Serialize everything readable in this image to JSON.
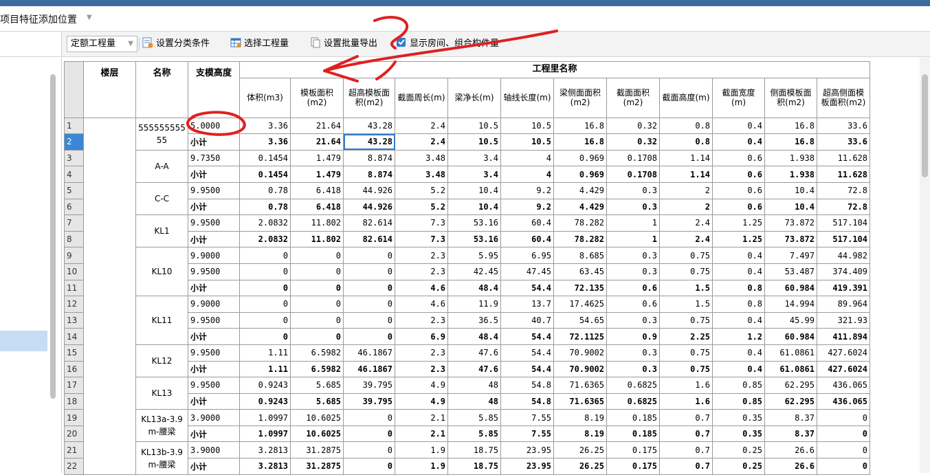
{
  "title_bar": {
    "title": "项目特征添加位置"
  },
  "toolbar": {
    "combo_value": "定额工程量",
    "buttons": [
      "设置分类条件",
      "选择工程量",
      "设置批量导出",
      "显示房间、组合构件量"
    ]
  },
  "colors": {
    "accent": "#3b86d6",
    "annotation": "#e02020",
    "header_bg": "#e6e6e6"
  },
  "table": {
    "group_header": "工程里名称",
    "fixed_headers": [
      "楼层",
      "名称",
      "支模高度"
    ],
    "columns": [
      "体积(m3)",
      "模板面积(m2)",
      "超高模板面积(m2)",
      "截面周长(m)",
      "梁净长(m)",
      "轴线长度(m)",
      "梁侧面面积(m2)",
      "截面面积(m2)",
      "截面高度(m)",
      "截面宽度(m)",
      "侧面模板面积(m2)",
      "超高侧面模板面积(m2)"
    ],
    "groups": [
      {
        "name": "55555555555",
        "rows": [
          {
            "n": "1",
            "h": "5.0000",
            "v": [
              "3.36",
              "21.64",
              "43.28",
              "2.4",
              "10.5",
              "10.5",
              "16.8",
              "0.32",
              "0.8",
              "0.4",
              "16.8",
              "33.6"
            ]
          },
          {
            "n": "2",
            "h": "小计",
            "v": [
              "3.36",
              "21.64",
              "43.28",
              "2.4",
              "10.5",
              "10.5",
              "16.8",
              "0.32",
              "0.8",
              "0.4",
              "16.8",
              "33.6"
            ]
          }
        ]
      },
      {
        "name": "A-A",
        "rows": [
          {
            "n": "3",
            "h": "9.7350",
            "v": [
              "0.1454",
              "1.479",
              "8.874",
              "3.48",
              "3.4",
              "4",
              "0.969",
              "0.1708",
              "1.14",
              "0.6",
              "1.938",
              "11.628"
            ]
          },
          {
            "n": "4",
            "h": "小计",
            "v": [
              "0.1454",
              "1.479",
              "8.874",
              "3.48",
              "3.4",
              "4",
              "0.969",
              "0.1708",
              "1.14",
              "0.6",
              "1.938",
              "11.628"
            ]
          }
        ]
      },
      {
        "name": "C-C",
        "rows": [
          {
            "n": "5",
            "h": "9.9500",
            "v": [
              "0.78",
              "6.418",
              "44.926",
              "5.2",
              "10.4",
              "9.2",
              "4.429",
              "0.3",
              "2",
              "0.6",
              "10.4",
              "72.8"
            ]
          },
          {
            "n": "6",
            "h": "小计",
            "v": [
              "0.78",
              "6.418",
              "44.926",
              "5.2",
              "10.4",
              "9.2",
              "4.429",
              "0.3",
              "2",
              "0.6",
              "10.4",
              "72.8"
            ]
          }
        ]
      },
      {
        "name": "KL1",
        "rows": [
          {
            "n": "7",
            "h": "9.9500",
            "v": [
              "2.0832",
              "11.802",
              "82.614",
              "7.3",
              "53.16",
              "60.4",
              "78.282",
              "1",
              "2.4",
              "1.25",
              "73.872",
              "517.104"
            ]
          },
          {
            "n": "8",
            "h": "小计",
            "v": [
              "2.0832",
              "11.802",
              "82.614",
              "7.3",
              "53.16",
              "60.4",
              "78.282",
              "1",
              "2.4",
              "1.25",
              "73.872",
              "517.104"
            ]
          }
        ]
      },
      {
        "name": "KL10",
        "rows": [
          {
            "n": "9",
            "h": "9.9000",
            "v": [
              "0",
              "0",
              "0",
              "2.3",
              "5.95",
              "6.95",
              "8.685",
              "0.3",
              "0.75",
              "0.4",
              "7.497",
              "44.982"
            ]
          },
          {
            "n": "10",
            "h": "9.9500",
            "v": [
              "0",
              "0",
              "0",
              "2.3",
              "42.45",
              "47.45",
              "63.45",
              "0.3",
              "0.75",
              "0.4",
              "53.487",
              "374.409"
            ]
          },
          {
            "n": "11",
            "h": "小计",
            "v": [
              "0",
              "0",
              "0",
              "4.6",
              "48.4",
              "54.4",
              "72.135",
              "0.6",
              "1.5",
              "0.8",
              "60.984",
              "419.391"
            ]
          }
        ]
      },
      {
        "name": "KL11",
        "rows": [
          {
            "n": "12",
            "h": "9.9000",
            "v": [
              "0",
              "0",
              "0",
              "4.6",
              "11.9",
              "13.7",
              "17.4625",
              "0.6",
              "1.5",
              "0.8",
              "14.994",
              "89.964"
            ]
          },
          {
            "n": "13",
            "h": "9.9500",
            "v": [
              "0",
              "0",
              "0",
              "2.3",
              "36.5",
              "40.7",
              "54.65",
              "0.3",
              "0.75",
              "0.4",
              "45.99",
              "321.93"
            ]
          },
          {
            "n": "14",
            "h": "小计",
            "v": [
              "0",
              "0",
              "0",
              "6.9",
              "48.4",
              "54.4",
              "72.1125",
              "0.9",
              "2.25",
              "1.2",
              "60.984",
              "411.894"
            ]
          }
        ]
      },
      {
        "name": "KL12",
        "rows": [
          {
            "n": "15",
            "h": "9.9500",
            "v": [
              "1.11",
              "6.5982",
              "46.1867",
              "2.3",
              "47.6",
              "54.4",
              "70.9002",
              "0.3",
              "0.75",
              "0.4",
              "61.0861",
              "427.6024"
            ]
          },
          {
            "n": "16",
            "h": "小计",
            "v": [
              "1.11",
              "6.5982",
              "46.1867",
              "2.3",
              "47.6",
              "54.4",
              "70.9002",
              "0.3",
              "0.75",
              "0.4",
              "61.0861",
              "427.6024"
            ]
          }
        ]
      },
      {
        "name": "KL13",
        "rows": [
          {
            "n": "17",
            "h": "9.9500",
            "v": [
              "0.9243",
              "5.685",
              "39.795",
              "4.9",
              "48",
              "54.8",
              "71.6365",
              "0.6825",
              "1.6",
              "0.85",
              "62.295",
              "436.065"
            ]
          },
          {
            "n": "18",
            "h": "小计",
            "v": [
              "0.9243",
              "5.685",
              "39.795",
              "4.9",
              "48",
              "54.8",
              "71.6365",
              "0.6825",
              "1.6",
              "0.85",
              "62.295",
              "436.065"
            ]
          }
        ]
      },
      {
        "name": "KL13a-3.9m-腰梁",
        "rows": [
          {
            "n": "19",
            "h": "3.9000",
            "v": [
              "1.0997",
              "10.6025",
              "0",
              "2.1",
              "5.85",
              "7.55",
              "8.19",
              "0.185",
              "0.7",
              "0.35",
              "8.37",
              "0"
            ]
          },
          {
            "n": "20",
            "h": "小计",
            "v": [
              "1.0997",
              "10.6025",
              "0",
              "2.1",
              "5.85",
              "7.55",
              "8.19",
              "0.185",
              "0.7",
              "0.35",
              "8.37",
              "0"
            ]
          }
        ]
      },
      {
        "name": "KL13b-3.9m-腰梁",
        "rows": [
          {
            "n": "21",
            "h": "3.9000",
            "v": [
              "3.2813",
              "31.2875",
              "0",
              "1.9",
              "18.75",
              "23.95",
              "26.25",
              "0.175",
              "0.7",
              "0.25",
              "26.6",
              "0"
            ]
          },
          {
            "n": "22",
            "h": "小计",
            "v": [
              "3.2813",
              "31.2875",
              "0",
              "1.9",
              "18.75",
              "23.95",
              "26.25",
              "0.175",
              "0.7",
              "0.25",
              "26.6",
              "0"
            ]
          }
        ]
      }
    ]
  }
}
